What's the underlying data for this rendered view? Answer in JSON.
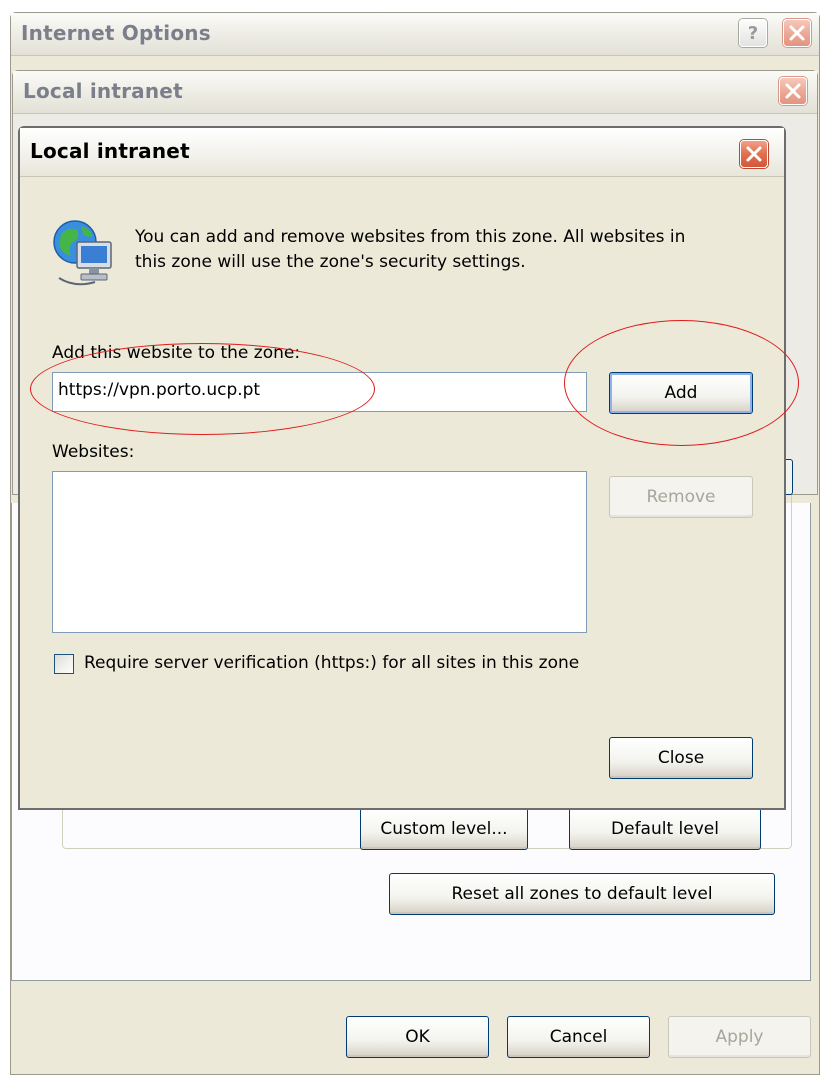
{
  "internet_options": {
    "title": "Internet Options",
    "help_label": "?",
    "buttons": {
      "custom_level": "Custom level...",
      "default_level": "Default level",
      "reset_all": "Reset all zones to default level",
      "ok": "OK",
      "cancel": "Cancel",
      "apply": "Apply"
    }
  },
  "local_intranet_window": {
    "title": "Local intranet"
  },
  "sites_dialog": {
    "title": "Local intranet",
    "info_text_line1": "You can add and remove websites from this zone. All websites in",
    "info_text_line2": "this zone will use the zone's security settings.",
    "add_label": "Add this website to the zone:",
    "website_value": "https://vpn.porto.ucp.pt",
    "add_button": "Add",
    "websites_label": "Websites:",
    "websites": [],
    "remove_button": "Remove",
    "require_verification_label": "Require server verification (https:) for all sites in this zone",
    "require_verification_checked": false,
    "close_button": "Close"
  },
  "icons": {
    "window_close": "close-icon",
    "help": "help-icon",
    "zone": "globe-computer-icon"
  },
  "colors": {
    "dialog_bg": "#ece9d8",
    "button_border": "#003c74",
    "close_red": "#d5563a",
    "annotation_red": "#e01b1b"
  }
}
